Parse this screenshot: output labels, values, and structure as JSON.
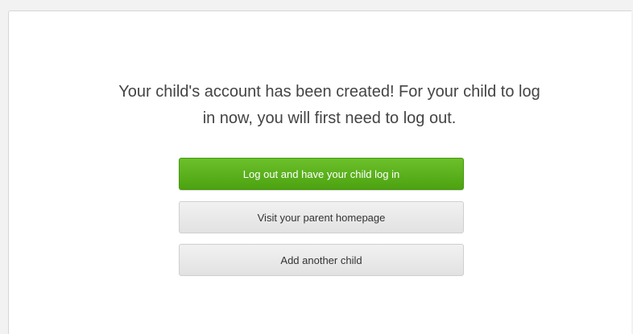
{
  "dialog": {
    "message_line1": "Your child's account has been created! For your child to log",
    "message_line2": "in now, you will first need to log out.",
    "buttons": {
      "logout_label": "Log out and have your child log in",
      "visit_label": "Visit your parent homepage",
      "add_child_label": "Add another child"
    }
  },
  "colors": {
    "primary_button": "#5bb01d",
    "secondary_button": "#e8e8e8",
    "text": "#444444"
  }
}
